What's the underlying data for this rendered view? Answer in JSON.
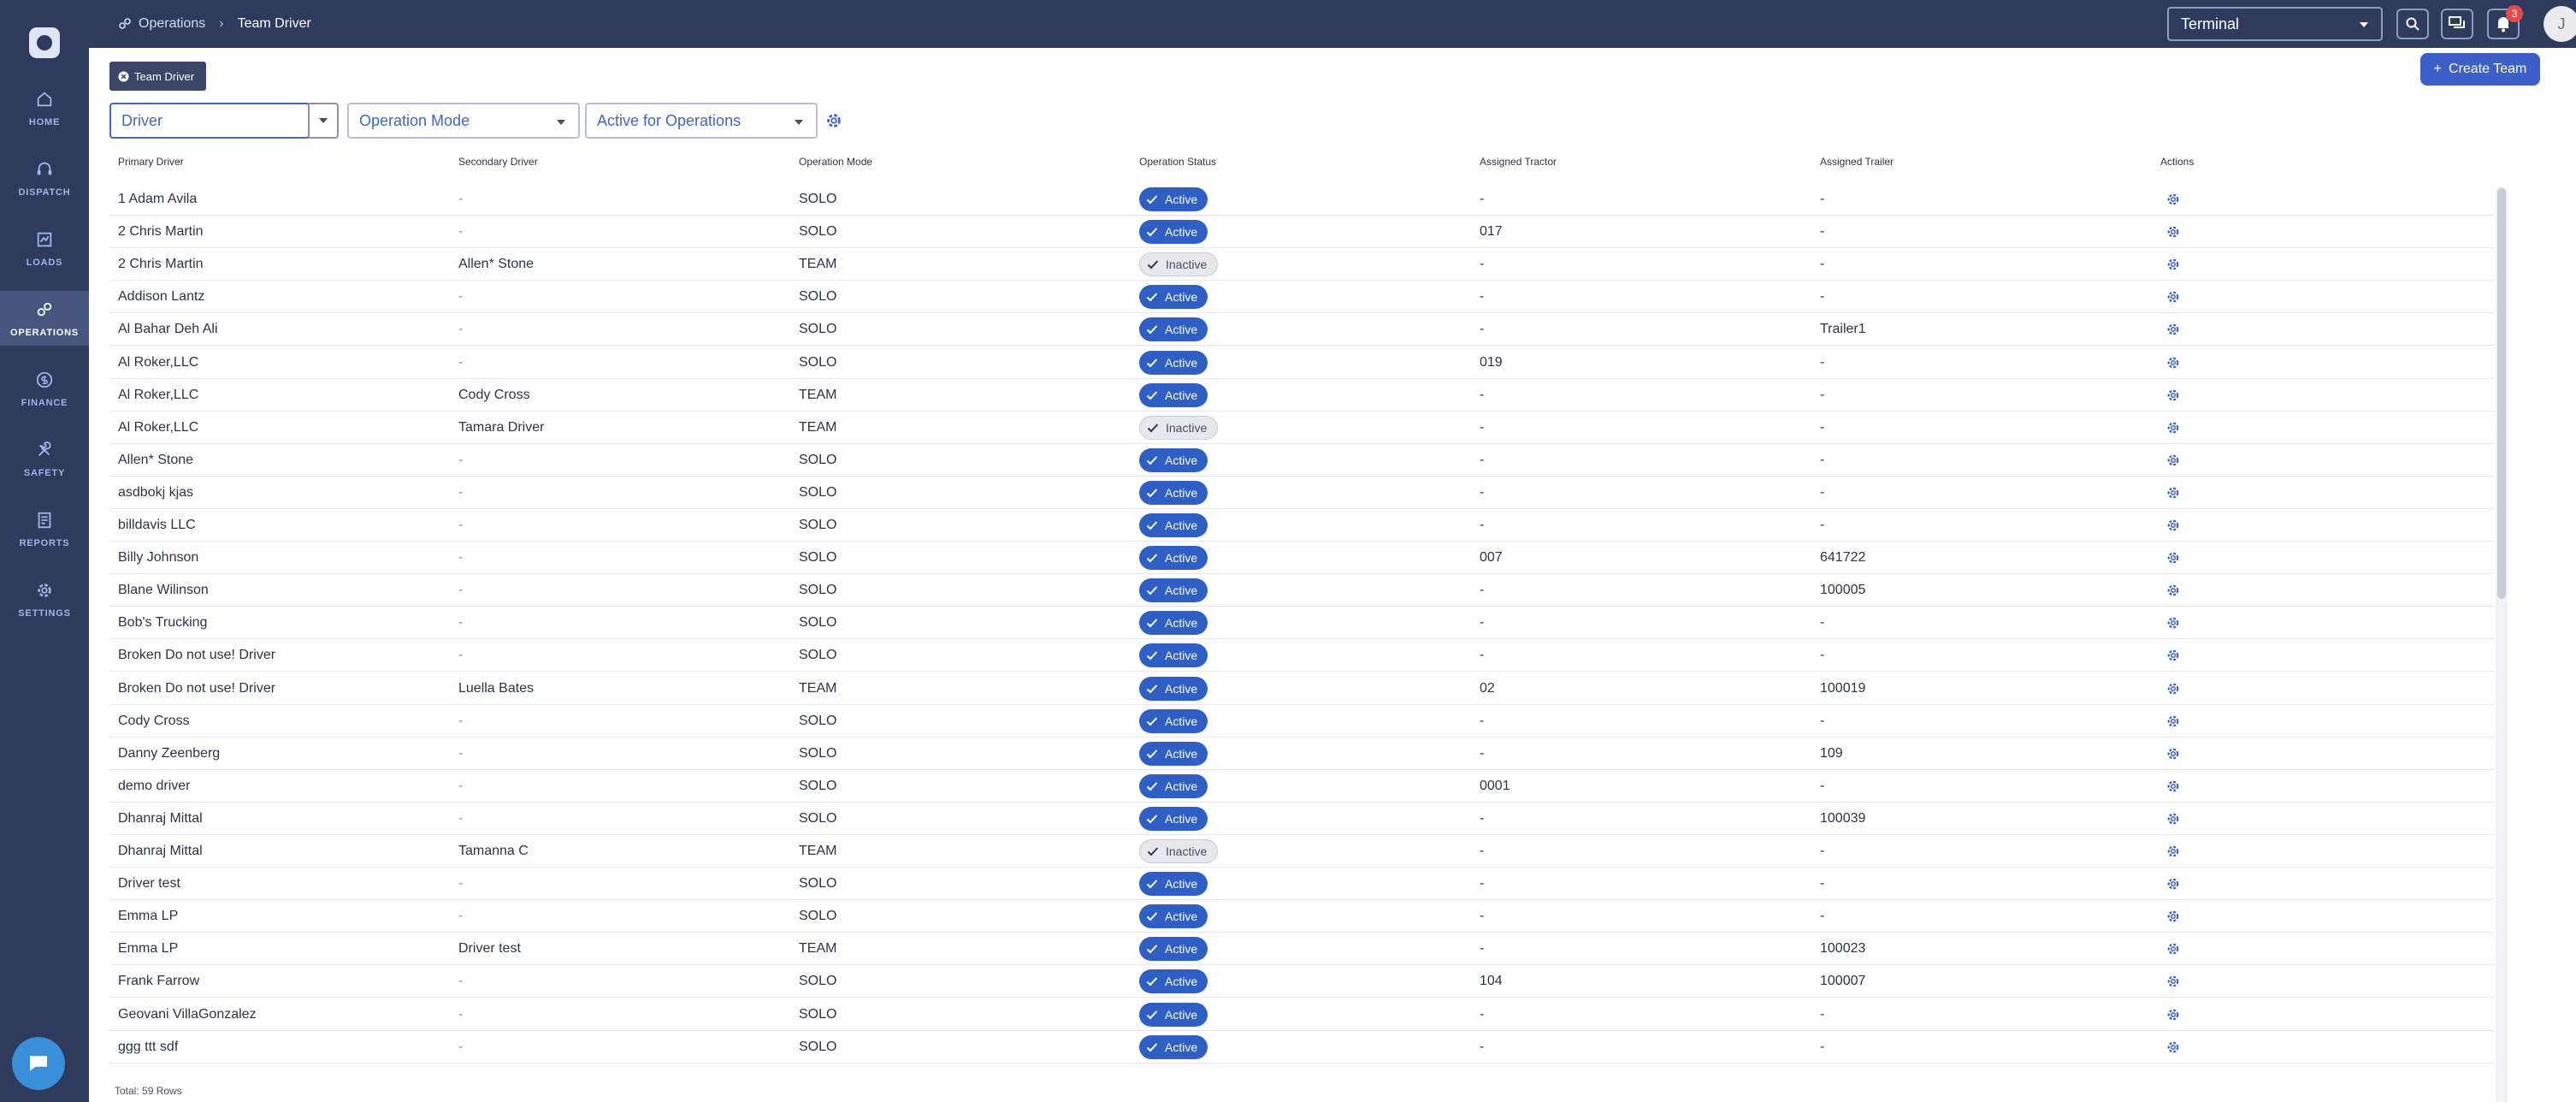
{
  "nav": [
    {
      "label": "HOME",
      "icon": "home-icon"
    },
    {
      "label": "DISPATCH",
      "icon": "headset-icon"
    },
    {
      "label": "LOADS",
      "icon": "loads-icon"
    },
    {
      "label": "OPERATIONS",
      "icon": "operations-icon",
      "active": true
    },
    {
      "label": "FINANCE",
      "icon": "dollar-icon"
    },
    {
      "label": "SAFETY",
      "icon": "wrench-icon"
    },
    {
      "label": "REPORTS",
      "icon": "report-icon"
    },
    {
      "label": "SETTINGS",
      "icon": "gear-icon"
    }
  ],
  "breadcrumb": {
    "parent": "Operations",
    "current": "Team Driver"
  },
  "terminal": {
    "value": "Terminal"
  },
  "notifications": {
    "count": "3"
  },
  "user": {
    "initial": "J"
  },
  "tab": {
    "label": "Team Driver"
  },
  "create_button": {
    "label": "Create Team"
  },
  "filters": {
    "driver": "Driver",
    "operation_mode": "Operation Mode",
    "active_for_operations": "Active for Operations"
  },
  "columns": {
    "primary": "Primary Driver",
    "secondary": "Secondary Driver",
    "mode": "Operation Mode",
    "status": "Operation Status",
    "tractor": "Assigned Tractor",
    "trailer": "Assigned Trailer",
    "actions": "Actions"
  },
  "rows": [
    {
      "primary": "1 Adam Avila",
      "secondary": "-",
      "mode": "SOLO",
      "status": "Active",
      "tractor": "-",
      "trailer": "-"
    },
    {
      "primary": "2 Chris Martin",
      "secondary": "-",
      "mode": "SOLO",
      "status": "Active",
      "tractor": "017",
      "trailer": "-"
    },
    {
      "primary": "2 Chris Martin",
      "secondary": "Allen* Stone",
      "mode": "TEAM",
      "status": "Inactive",
      "tractor": "-",
      "trailer": "-"
    },
    {
      "primary": "Addison Lantz",
      "secondary": "-",
      "mode": "SOLO",
      "status": "Active",
      "tractor": "-",
      "trailer": "-"
    },
    {
      "primary": "Al Bahar Deh Ali",
      "secondary": "-",
      "mode": "SOLO",
      "status": "Active",
      "tractor": "-",
      "trailer": "Trailer1"
    },
    {
      "primary": "Al Roker,LLC",
      "secondary": "-",
      "mode": "SOLO",
      "status": "Active",
      "tractor": "019",
      "trailer": "-"
    },
    {
      "primary": "Al Roker,LLC",
      "secondary": "Cody Cross",
      "mode": "TEAM",
      "status": "Active",
      "tractor": "-",
      "trailer": "-"
    },
    {
      "primary": "Al Roker,LLC",
      "secondary": "Tamara Driver",
      "mode": "TEAM",
      "status": "Inactive",
      "tractor": "-",
      "trailer": "-"
    },
    {
      "primary": "Allen* Stone",
      "secondary": "-",
      "mode": "SOLO",
      "status": "Active",
      "tractor": "-",
      "trailer": "-"
    },
    {
      "primary": "asdbokj kjas",
      "secondary": "-",
      "mode": "SOLO",
      "status": "Active",
      "tractor": "-",
      "trailer": "-"
    },
    {
      "primary": "billdavis LLC",
      "secondary": "-",
      "mode": "SOLO",
      "status": "Active",
      "tractor": "-",
      "trailer": "-"
    },
    {
      "primary": "Billy Johnson",
      "secondary": "-",
      "mode": "SOLO",
      "status": "Active",
      "tractor": "007",
      "trailer": "641722"
    },
    {
      "primary": "Blane Wilinson",
      "secondary": "-",
      "mode": "SOLO",
      "status": "Active",
      "tractor": "-",
      "trailer": "100005"
    },
    {
      "primary": "Bob's Trucking",
      "secondary": "-",
      "mode": "SOLO",
      "status": "Active",
      "tractor": "-",
      "trailer": "-"
    },
    {
      "primary": "Broken Do not use! Driver",
      "secondary": "-",
      "mode": "SOLO",
      "status": "Active",
      "tractor": "-",
      "trailer": "-"
    },
    {
      "primary": "Broken Do not use! Driver",
      "secondary": "Luella Bates",
      "mode": "TEAM",
      "status": "Active",
      "tractor": "02",
      "trailer": "100019"
    },
    {
      "primary": "Cody Cross",
      "secondary": "-",
      "mode": "SOLO",
      "status": "Active",
      "tractor": "-",
      "trailer": "-"
    },
    {
      "primary": "Danny Zeenberg",
      "secondary": "-",
      "mode": "SOLO",
      "status": "Active",
      "tractor": "-",
      "trailer": "109"
    },
    {
      "primary": "demo driver",
      "secondary": "-",
      "mode": "SOLO",
      "status": "Active",
      "tractor": "0001",
      "trailer": "-"
    },
    {
      "primary": "Dhanraj Mittal",
      "secondary": "-",
      "mode": "SOLO",
      "status": "Active",
      "tractor": "-",
      "trailer": "100039"
    },
    {
      "primary": "Dhanraj Mittal",
      "secondary": "Tamanna C",
      "mode": "TEAM",
      "status": "Inactive",
      "tractor": "-",
      "trailer": "-"
    },
    {
      "primary": "Driver test",
      "secondary": "-",
      "mode": "SOLO",
      "status": "Active",
      "tractor": "-",
      "trailer": "-"
    },
    {
      "primary": "Emma LP",
      "secondary": "-",
      "mode": "SOLO",
      "status": "Active",
      "tractor": "-",
      "trailer": "-"
    },
    {
      "primary": "Emma LP",
      "secondary": "Driver test",
      "mode": "TEAM",
      "status": "Active",
      "tractor": "-",
      "trailer": "100023"
    },
    {
      "primary": "Frank Farrow",
      "secondary": "-",
      "mode": "SOLO",
      "status": "Active",
      "tractor": "104",
      "trailer": "100007"
    },
    {
      "primary": "Geovani VillaGonzalez",
      "secondary": "-",
      "mode": "SOLO",
      "status": "Active",
      "tractor": "-",
      "trailer": "-"
    },
    {
      "primary": "ggg ttt sdf",
      "secondary": "-",
      "mode": "SOLO",
      "status": "Active",
      "tractor": "-",
      "trailer": "-"
    }
  ],
  "footer": {
    "total": "Total: 59 Rows"
  }
}
